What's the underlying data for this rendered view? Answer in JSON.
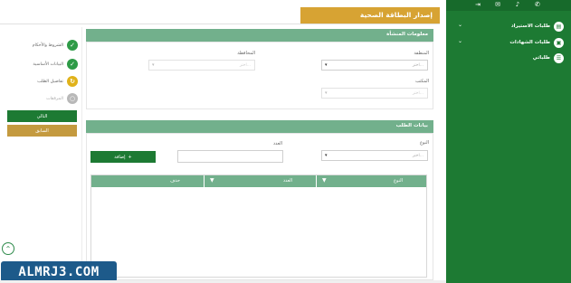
{
  "header": {
    "title": "إصدار البطاقة الصحية"
  },
  "sidebar": {
    "top_icons": [
      "logout-icon",
      "mail-icon",
      "bell-icon",
      "chat-icon"
    ],
    "items": [
      {
        "label": "طلبات الاستيراد",
        "icon": "document-icon",
        "has_chevron": true
      },
      {
        "label": "طلبات الشهادات",
        "icon": "certificate-icon",
        "has_chevron": true
      },
      {
        "label": "طلباتي",
        "icon": "list-icon",
        "has_chevron": false
      }
    ]
  },
  "steps": [
    {
      "label": "الشروط والأحكام",
      "status": "done",
      "color": "#2e9b47"
    },
    {
      "label": "البيانات الأساسية",
      "status": "done",
      "color": "#2e9b47"
    },
    {
      "label": "تفاصيل الطلب",
      "status": "current",
      "color": "#e0b21a"
    },
    {
      "label": "المرفقات",
      "status": "pending",
      "color": "#b8b8b8"
    }
  ],
  "buttons": {
    "next": "التالي",
    "prev": "السابق",
    "add": "إضافة"
  },
  "facility_panel": {
    "title": "معلومات المنشأة",
    "fields": [
      {
        "label": "المنطقة",
        "placeholder": "اختر..."
      },
      {
        "label": "المحافظة",
        "placeholder": "اختر..."
      },
      {
        "label": "المكتب",
        "placeholder": "اختر..."
      }
    ]
  },
  "request_panel": {
    "title": "بيانات الطلب",
    "type_label": "النوع",
    "type_placeholder": "اختر...",
    "count_label": "العدد"
  },
  "table": {
    "columns": [
      "النوع",
      "العدد",
      "حذف"
    ],
    "rows": []
  },
  "footer": {
    "logo_text": "ALMRJ3.COM"
  },
  "colors": {
    "brand_green": "#1d7a33",
    "panel_green": "#72b08c",
    "gold": "#d7a333"
  }
}
